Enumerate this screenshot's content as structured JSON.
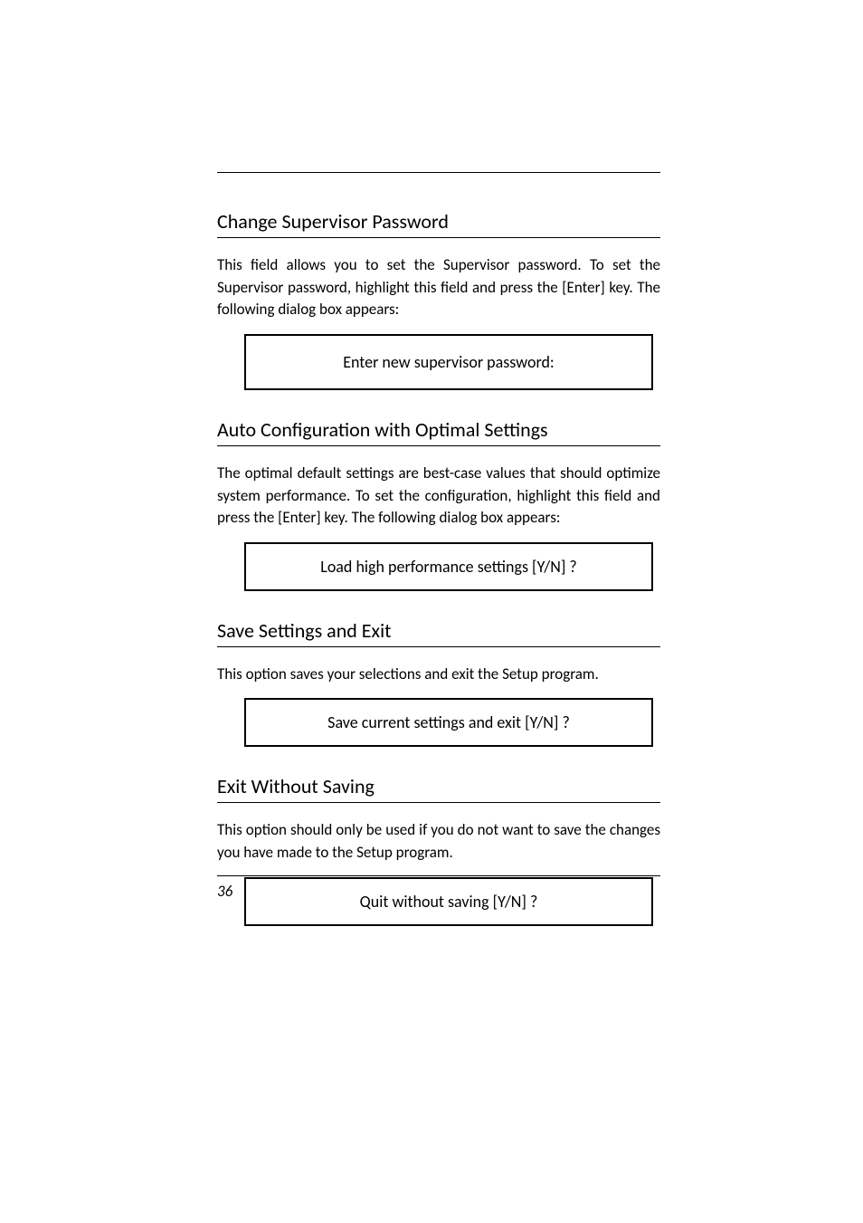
{
  "sections": [
    {
      "heading": "Change Supervisor Password",
      "body": "This field allows you to set the Supervisor password.  To set the Supervisor password, highlight this field and press the [Enter] key.  The following dialog box appears:",
      "dialog": "Enter new supervisor password:"
    },
    {
      "heading": "Auto Configuration with Optimal Settings",
      "body": "The optimal default settings are best-case values that should optimize system performance.  To set the configuration, highlight this field and press the [Enter] key.  The following dialog box appears:",
      "dialog": "Load high performance settings [Y/N]  ?"
    },
    {
      "heading": "Save Settings and Exit",
      "body": "This option saves your selections and exit the Setup program.",
      "dialog": "Save current settings and exit [Y/N] ?"
    },
    {
      "heading": "Exit Without Saving",
      "body": "This option should only be used if you do not want to save the changes you have made to the Setup program.",
      "dialog": "Quit without saving [Y/N]  ?"
    }
  ],
  "page_number": "36"
}
